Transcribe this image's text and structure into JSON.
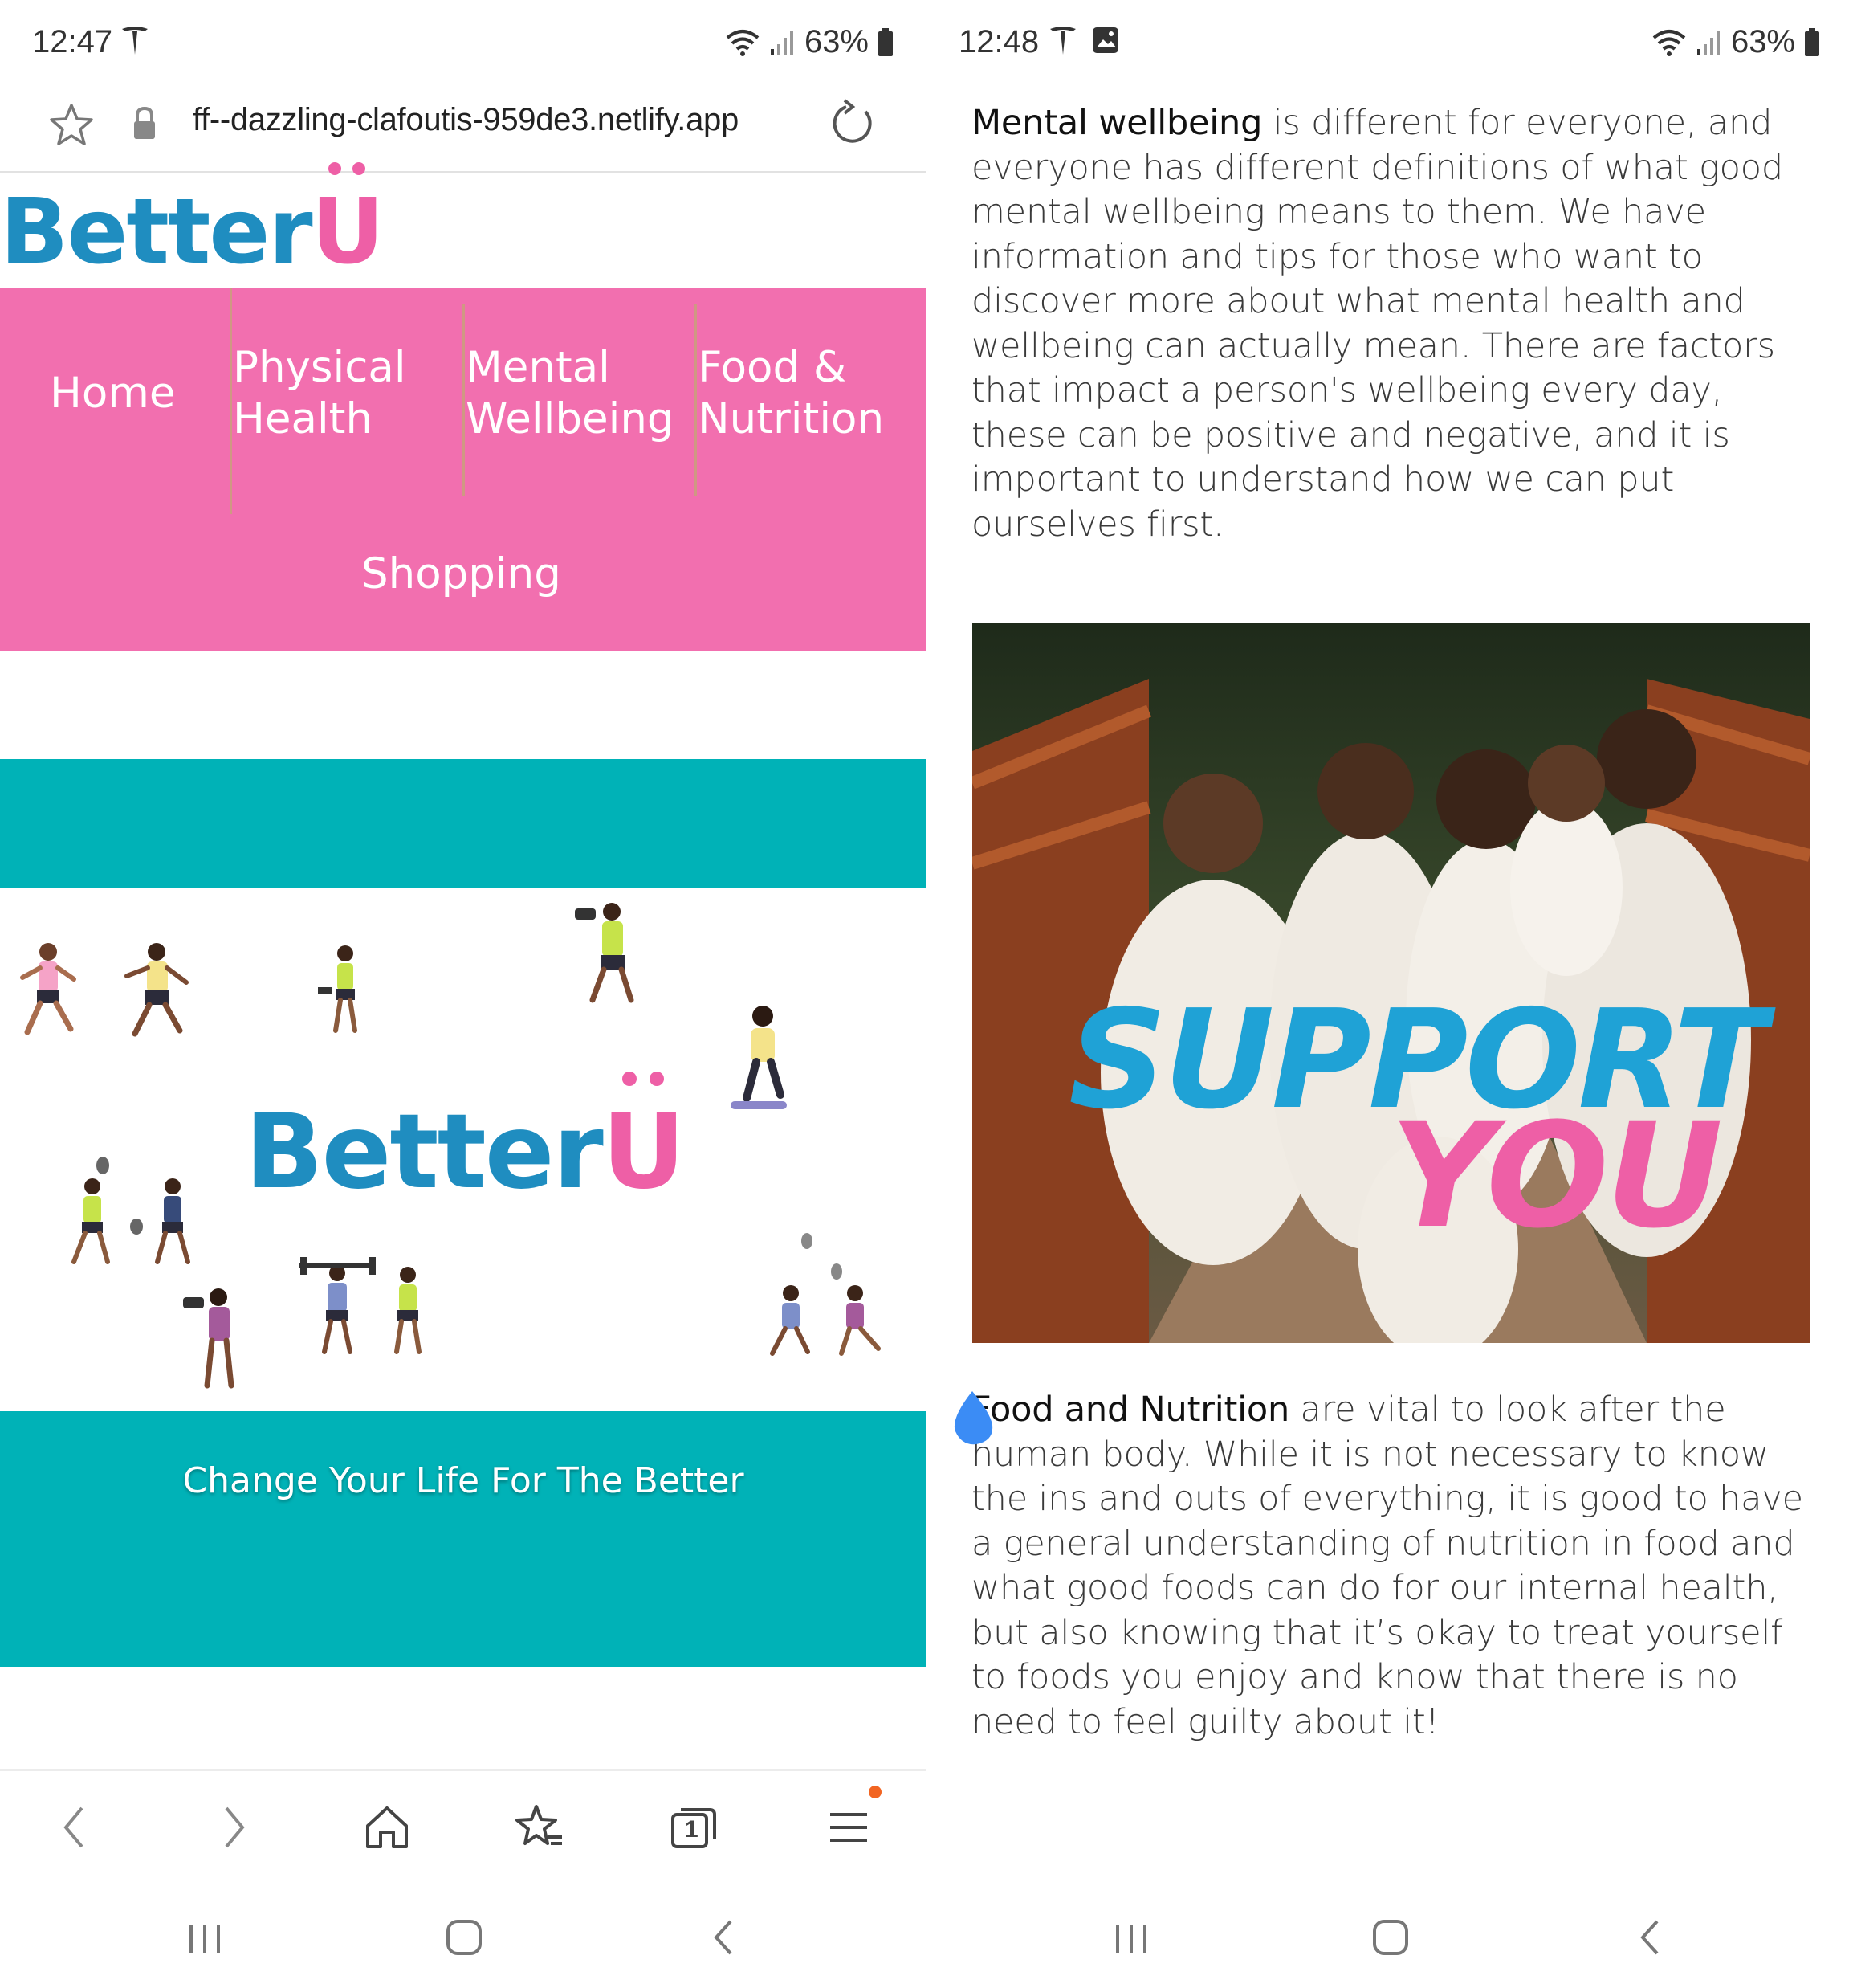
{
  "left_screen": {
    "status": {
      "time": "12:47",
      "battery": "63%"
    },
    "address_bar": {
      "url": "ff--dazzling-clafoutis-959de3.netlify.app"
    },
    "logo": {
      "text": "Better",
      "accent_letter": "U"
    },
    "nav": {
      "home": "Home",
      "physical_1": "Physical",
      "physical_2": "Health",
      "mental_1": "Mental",
      "mental_2": "Wellbeing",
      "food_1": "Food &",
      "food_2": "Nutrition",
      "shopping": "Shopping"
    },
    "hero_logo": {
      "text": "Better",
      "accent_letter": "U"
    },
    "tagline": "Change Your Life For The Better",
    "toolbar": {
      "icons": [
        "back-icon",
        "forward-icon",
        "home-icon",
        "bookmarks-icon",
        "tabs-icon",
        "menu-icon"
      ],
      "tab_count": "1"
    }
  },
  "right_screen": {
    "status": {
      "time": "12:48",
      "battery": "63%"
    },
    "mental_para": {
      "lead": "Mental wellbeing",
      "body": " is different for everyone, and everyone has different definitions of what good mental wellbeing means to them. We have information and tips for those who want to discover more about what mental health and wellbeing can actually mean. There are factors that impact a person's wellbeing every day, these can be positive and negative, and it is important to understand how we can put ourselves first."
    },
    "photo": {
      "word1": "SUPPORT",
      "word2": "YOU"
    },
    "food_para": {
      "lead": "Food and Nutrition",
      "body": " are vital to look after the human body. While it is not necessary to know the ins and outs of everything, it is good to have a general understanding of nutrition in food and what good foods can do for our internal health, but also knowing that it’s okay to treat yourself to foods you enjoy and know that there is no need to feel guilty about it!"
    }
  },
  "colors": {
    "brand_blue": "#1f8dc0",
    "brand_pink": "#ee5fa6",
    "nav_pink": "#f26faf",
    "teal": "#00b2b7",
    "notification": "#f26522"
  }
}
